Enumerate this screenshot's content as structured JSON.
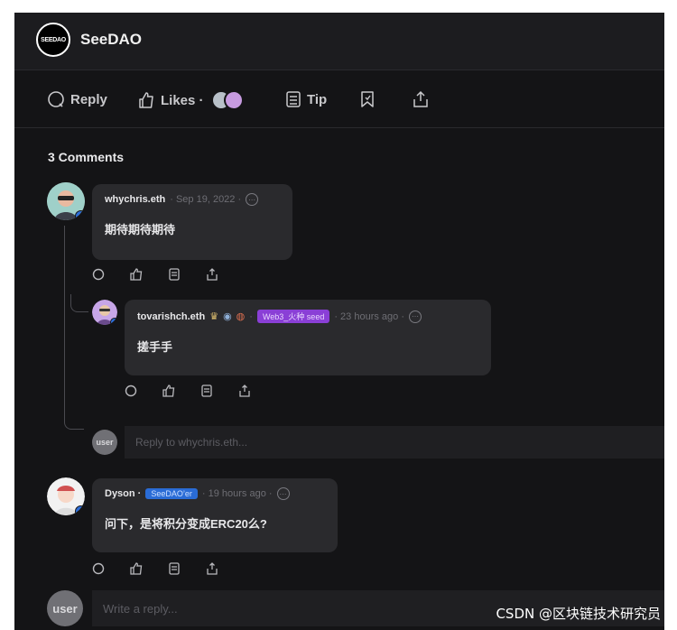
{
  "app": {
    "title": "SeeDAO",
    "logo_text": "SEEDAO"
  },
  "actions": {
    "reply_label": "Reply",
    "likes_label": "Likes ·",
    "tip_label": "Tip"
  },
  "comments_count": "3 Comments",
  "comments": [
    {
      "user": "whychris.eth",
      "date": "· Sep 19, 2022 ·",
      "text": "期待期待期待"
    },
    {
      "user": "tovarishch.eth",
      "tag": "Web3_火种 seed",
      "date": "· 23 hours ago ·",
      "text": "搓手手"
    },
    {
      "user": "Dyson ·",
      "tag": "SeeDAO’er",
      "date": "· 19 hours ago ·",
      "text": "问下，是将积分变成ERC20么?"
    }
  ],
  "reply_to_placeholder": "Reply to whychris.eth...",
  "write_reply_placeholder": "Write a reply...",
  "user_avatar_text": "user",
  "watermark": "CSDN @区块链技术研究员",
  "colors": {
    "background": "#141416",
    "bubble": "#2a2a2d",
    "tag_purple": "#8a3fd6",
    "tag_blue": "#2a6cd6"
  }
}
